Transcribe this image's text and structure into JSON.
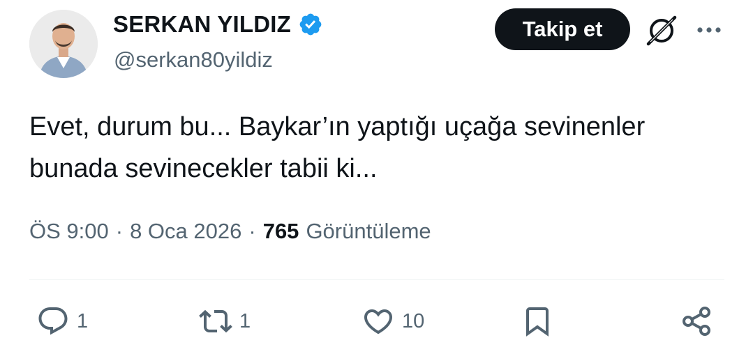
{
  "author": {
    "display_name": "SERKAN YILDIZ",
    "handle": "@serkan80yildiz",
    "verified": true,
    "verified_color": "#1d9bf0"
  },
  "actions": {
    "follow_label": "Takip et",
    "grok_icon": "grok-icon",
    "more_icon": "more-icon"
  },
  "tweet": {
    "text_line1": "Evet, durum bu... Baykar’ın yaptığı uçağa sevinenler",
    "text_line2": "bunada sevinecekler tabii ki..."
  },
  "meta": {
    "time": "ÖS 9:00",
    "separator": "·",
    "date": "8 Oca 2026",
    "views_count": "765",
    "views_label": "Görüntüleme"
  },
  "engagement": {
    "replies": "1",
    "retweets": "1",
    "likes": "10"
  },
  "colors": {
    "text": "#0f1419",
    "secondary": "#536471",
    "button_bg": "#0f1419",
    "divider": "#eff3f4"
  }
}
